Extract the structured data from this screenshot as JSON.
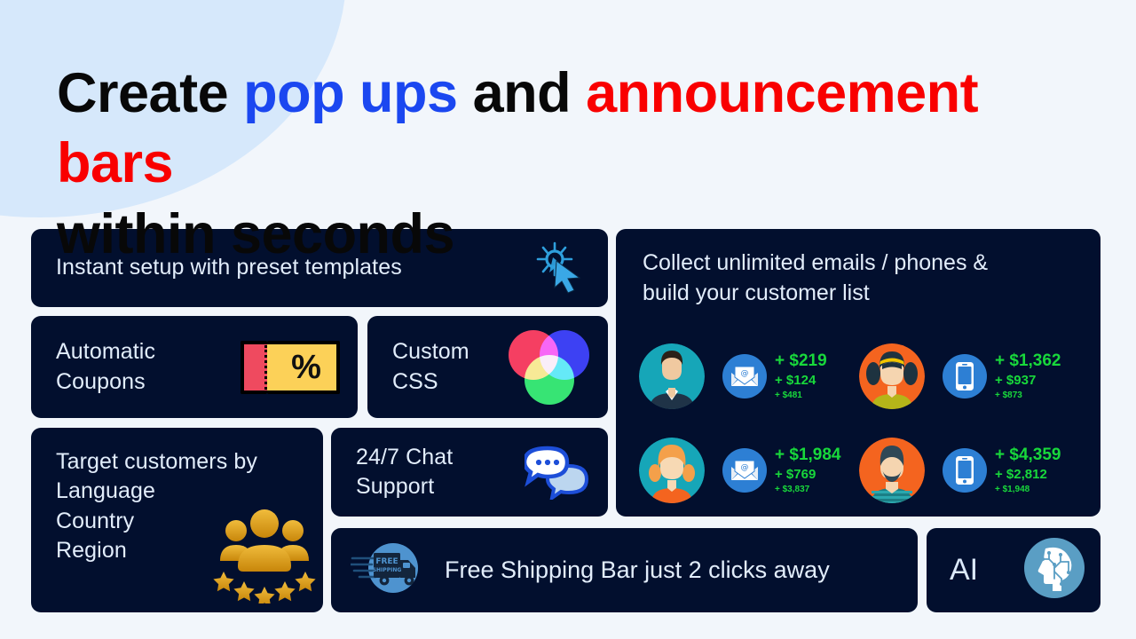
{
  "headline": {
    "part1": "Create ",
    "popups": "pop ups",
    "part2": " and ",
    "bars": "announcement bars",
    "line2": "within seconds",
    "color_blue": "#1b47f0",
    "color_red": "#f90000"
  },
  "theme": {
    "page_bg": "#f2f6fb",
    "blob": "#d6e8fb",
    "card_bg": "#020f2e",
    "card_text": "#e2edfb",
    "money_green": "#18d83b",
    "icon_blue": "#2d7fd4",
    "gold": "#d99e10"
  },
  "cards": {
    "instant": {
      "title": "Instant setup with preset templates",
      "icon": "click-cursor-icon"
    },
    "coupons": {
      "title": "Automatic\nCoupons",
      "line1": "Automatic",
      "line2": "Coupons",
      "icon": "coupon-ticket-icon",
      "symbol": "%"
    },
    "css": {
      "line1": "Custom",
      "line2": "CSS",
      "icon": "rgb-venn-icon"
    },
    "target": {
      "line1": "Target customers by",
      "line2": "Language",
      "line3": "Country",
      "line4": "Region",
      "icon": "people-group-stars-icon",
      "stars": 5
    },
    "chat": {
      "line1": "24/7 Chat",
      "line2": "Support",
      "icon": "chat-bubbles-icon"
    },
    "shipping": {
      "title": "Free Shipping Bar just 2 clicks away",
      "icon": "delivery-truck-icon",
      "truck_label_top": "FREE",
      "truck_label_bottom": "SHIPPING"
    },
    "ai": {
      "title": "AI",
      "icon": "ai-brain-head-icon"
    },
    "collect": {
      "title_line1": "Collect unlimited emails / phones &",
      "title_line2": "build your customer list",
      "entries": [
        {
          "avatar": "businessman-avatar",
          "avatar_bg": "#16a6b8",
          "channel": "email-icon",
          "amount_large": "+ $219",
          "amount_medium": "+ $124",
          "amount_small": "+ $481"
        },
        {
          "avatar": "pigtails-girl-avatar",
          "avatar_bg": "#f4641f",
          "channel": "phone-icon",
          "amount_large": "+ $1,362",
          "amount_medium": "+ $937",
          "amount_small": "+ $873"
        },
        {
          "avatar": "blonde-woman-avatar",
          "avatar_bg": "#16a6b8",
          "channel": "email-icon",
          "amount_large": "+ $1,984",
          "amount_medium": "+ $769",
          "amount_small": "+ $3,837"
        },
        {
          "avatar": "bearded-man-avatar",
          "avatar_bg": "#f4641f",
          "channel": "phone-icon",
          "amount_large": "+ $4,359",
          "amount_medium": "+ $2,812",
          "amount_small": "+ $1,948"
        }
      ]
    }
  }
}
